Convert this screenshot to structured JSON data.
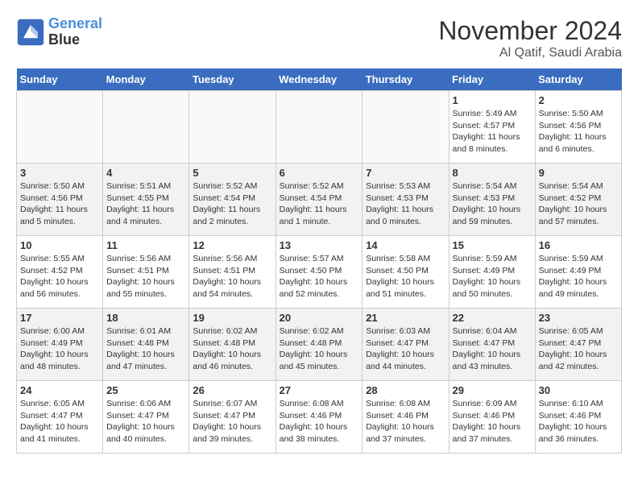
{
  "logo": {
    "line1": "General",
    "line2": "Blue"
  },
  "title": "November 2024",
  "subtitle": "Al Qatif, Saudi Arabia",
  "days_of_week": [
    "Sunday",
    "Monday",
    "Tuesday",
    "Wednesday",
    "Thursday",
    "Friday",
    "Saturday"
  ],
  "weeks": [
    [
      {
        "num": "",
        "text": ""
      },
      {
        "num": "",
        "text": ""
      },
      {
        "num": "",
        "text": ""
      },
      {
        "num": "",
        "text": ""
      },
      {
        "num": "",
        "text": ""
      },
      {
        "num": "1",
        "text": "Sunrise: 5:49 AM\nSunset: 4:57 PM\nDaylight: 11 hours\nand 8 minutes."
      },
      {
        "num": "2",
        "text": "Sunrise: 5:50 AM\nSunset: 4:56 PM\nDaylight: 11 hours\nand 6 minutes."
      }
    ],
    [
      {
        "num": "3",
        "text": "Sunrise: 5:50 AM\nSunset: 4:56 PM\nDaylight: 11 hours\nand 5 minutes."
      },
      {
        "num": "4",
        "text": "Sunrise: 5:51 AM\nSunset: 4:55 PM\nDaylight: 11 hours\nand 4 minutes."
      },
      {
        "num": "5",
        "text": "Sunrise: 5:52 AM\nSunset: 4:54 PM\nDaylight: 11 hours\nand 2 minutes."
      },
      {
        "num": "6",
        "text": "Sunrise: 5:52 AM\nSunset: 4:54 PM\nDaylight: 11 hours\nand 1 minute."
      },
      {
        "num": "7",
        "text": "Sunrise: 5:53 AM\nSunset: 4:53 PM\nDaylight: 11 hours\nand 0 minutes."
      },
      {
        "num": "8",
        "text": "Sunrise: 5:54 AM\nSunset: 4:53 PM\nDaylight: 10 hours\nand 59 minutes."
      },
      {
        "num": "9",
        "text": "Sunrise: 5:54 AM\nSunset: 4:52 PM\nDaylight: 10 hours\nand 57 minutes."
      }
    ],
    [
      {
        "num": "10",
        "text": "Sunrise: 5:55 AM\nSunset: 4:52 PM\nDaylight: 10 hours\nand 56 minutes."
      },
      {
        "num": "11",
        "text": "Sunrise: 5:56 AM\nSunset: 4:51 PM\nDaylight: 10 hours\nand 55 minutes."
      },
      {
        "num": "12",
        "text": "Sunrise: 5:56 AM\nSunset: 4:51 PM\nDaylight: 10 hours\nand 54 minutes."
      },
      {
        "num": "13",
        "text": "Sunrise: 5:57 AM\nSunset: 4:50 PM\nDaylight: 10 hours\nand 52 minutes."
      },
      {
        "num": "14",
        "text": "Sunrise: 5:58 AM\nSunset: 4:50 PM\nDaylight: 10 hours\nand 51 minutes."
      },
      {
        "num": "15",
        "text": "Sunrise: 5:59 AM\nSunset: 4:49 PM\nDaylight: 10 hours\nand 50 minutes."
      },
      {
        "num": "16",
        "text": "Sunrise: 5:59 AM\nSunset: 4:49 PM\nDaylight: 10 hours\nand 49 minutes."
      }
    ],
    [
      {
        "num": "17",
        "text": "Sunrise: 6:00 AM\nSunset: 4:49 PM\nDaylight: 10 hours\nand 48 minutes."
      },
      {
        "num": "18",
        "text": "Sunrise: 6:01 AM\nSunset: 4:48 PM\nDaylight: 10 hours\nand 47 minutes."
      },
      {
        "num": "19",
        "text": "Sunrise: 6:02 AM\nSunset: 4:48 PM\nDaylight: 10 hours\nand 46 minutes."
      },
      {
        "num": "20",
        "text": "Sunrise: 6:02 AM\nSunset: 4:48 PM\nDaylight: 10 hours\nand 45 minutes."
      },
      {
        "num": "21",
        "text": "Sunrise: 6:03 AM\nSunset: 4:47 PM\nDaylight: 10 hours\nand 44 minutes."
      },
      {
        "num": "22",
        "text": "Sunrise: 6:04 AM\nSunset: 4:47 PM\nDaylight: 10 hours\nand 43 minutes."
      },
      {
        "num": "23",
        "text": "Sunrise: 6:05 AM\nSunset: 4:47 PM\nDaylight: 10 hours\nand 42 minutes."
      }
    ],
    [
      {
        "num": "24",
        "text": "Sunrise: 6:05 AM\nSunset: 4:47 PM\nDaylight: 10 hours\nand 41 minutes."
      },
      {
        "num": "25",
        "text": "Sunrise: 6:06 AM\nSunset: 4:47 PM\nDaylight: 10 hours\nand 40 minutes."
      },
      {
        "num": "26",
        "text": "Sunrise: 6:07 AM\nSunset: 4:47 PM\nDaylight: 10 hours\nand 39 minutes."
      },
      {
        "num": "27",
        "text": "Sunrise: 6:08 AM\nSunset: 4:46 PM\nDaylight: 10 hours\nand 38 minutes."
      },
      {
        "num": "28",
        "text": "Sunrise: 6:08 AM\nSunset: 4:46 PM\nDaylight: 10 hours\nand 37 minutes."
      },
      {
        "num": "29",
        "text": "Sunrise: 6:09 AM\nSunset: 4:46 PM\nDaylight: 10 hours\nand 37 minutes."
      },
      {
        "num": "30",
        "text": "Sunrise: 6:10 AM\nSunset: 4:46 PM\nDaylight: 10 hours\nand 36 minutes."
      }
    ]
  ]
}
